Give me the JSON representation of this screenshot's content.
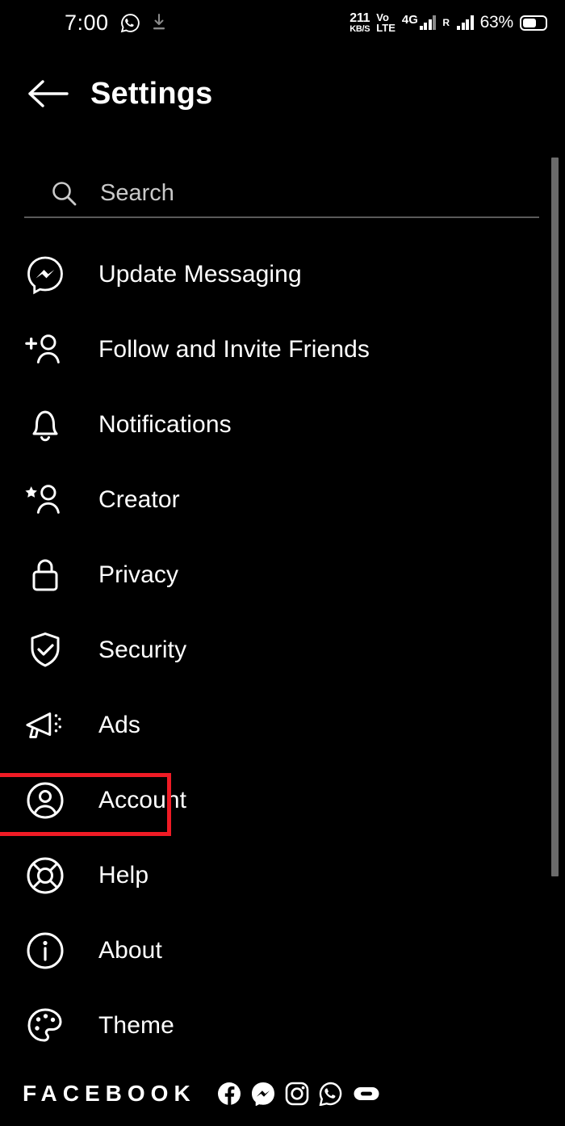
{
  "statusbar": {
    "clock": "7:00",
    "whatsapp_icon": "whatsapp-icon",
    "download_icon": "download-icon",
    "net_speed_value": "211",
    "net_speed_unit": "KB/S",
    "volte_line1": "Vo",
    "volte_line2": "LTE",
    "network_type": "4G",
    "roaming": "R",
    "battery_percent": "63%"
  },
  "appbar": {
    "back_icon": "arrow-left-icon",
    "title": "Settings"
  },
  "search": {
    "icon": "search-icon",
    "placeholder": "Search",
    "value": ""
  },
  "list": {
    "items": [
      {
        "label": "Update Messaging",
        "icon": "messenger-icon",
        "highlighted": false
      },
      {
        "label": "Follow and Invite Friends",
        "icon": "person-add-icon",
        "highlighted": false
      },
      {
        "label": "Notifications",
        "icon": "bell-icon",
        "highlighted": false
      },
      {
        "label": "Creator",
        "icon": "person-star-icon",
        "highlighted": false
      },
      {
        "label": "Privacy",
        "icon": "lock-icon",
        "highlighted": false
      },
      {
        "label": "Security",
        "icon": "shield-check-icon",
        "highlighted": false
      },
      {
        "label": "Ads",
        "icon": "megaphone-icon",
        "highlighted": false
      },
      {
        "label": "Account",
        "icon": "account-circle-icon",
        "highlighted": true
      },
      {
        "label": "Help",
        "icon": "lifebuoy-icon",
        "highlighted": false
      },
      {
        "label": "About",
        "icon": "info-circle-icon",
        "highlighted": false
      },
      {
        "label": "Theme",
        "icon": "palette-icon",
        "highlighted": false
      }
    ]
  },
  "footer": {
    "brand": "FACEBOOK",
    "icons": [
      "facebook-icon",
      "messenger-icon",
      "instagram-icon",
      "whatsapp-icon",
      "oculus-icon"
    ]
  },
  "colors": {
    "background": "#000000",
    "text": "#ffffff",
    "muted_text": "#c9c9c9",
    "highlight_border": "#ef1b25",
    "divider": "#5a5a5a",
    "scrollbar": "#6b6b6b"
  }
}
